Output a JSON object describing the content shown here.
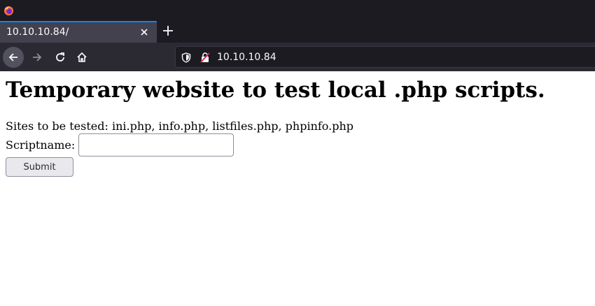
{
  "browser": {
    "tab_title": "10.10.10.84/",
    "url": "10.10.10.84",
    "accent_color": "#0a84ff"
  },
  "icons": {
    "logo": "firefox-logo-icon",
    "tab_close": "close-icon",
    "new_tab": "plus-icon",
    "back": "arrow-left-icon",
    "forward": "arrow-right-icon",
    "reload": "reload-icon",
    "home": "home-icon",
    "tracking": "shield-icon",
    "insecure": "insecure-lock-icon"
  },
  "page": {
    "title": "Temporary website to test local .php scripts.",
    "sites_text": "Sites to be tested: ini.php, info.php, listfiles.php, phpinfo.php",
    "form": {
      "label": "Scriptname:",
      "input_value": "",
      "submit_label": "Submit"
    }
  }
}
